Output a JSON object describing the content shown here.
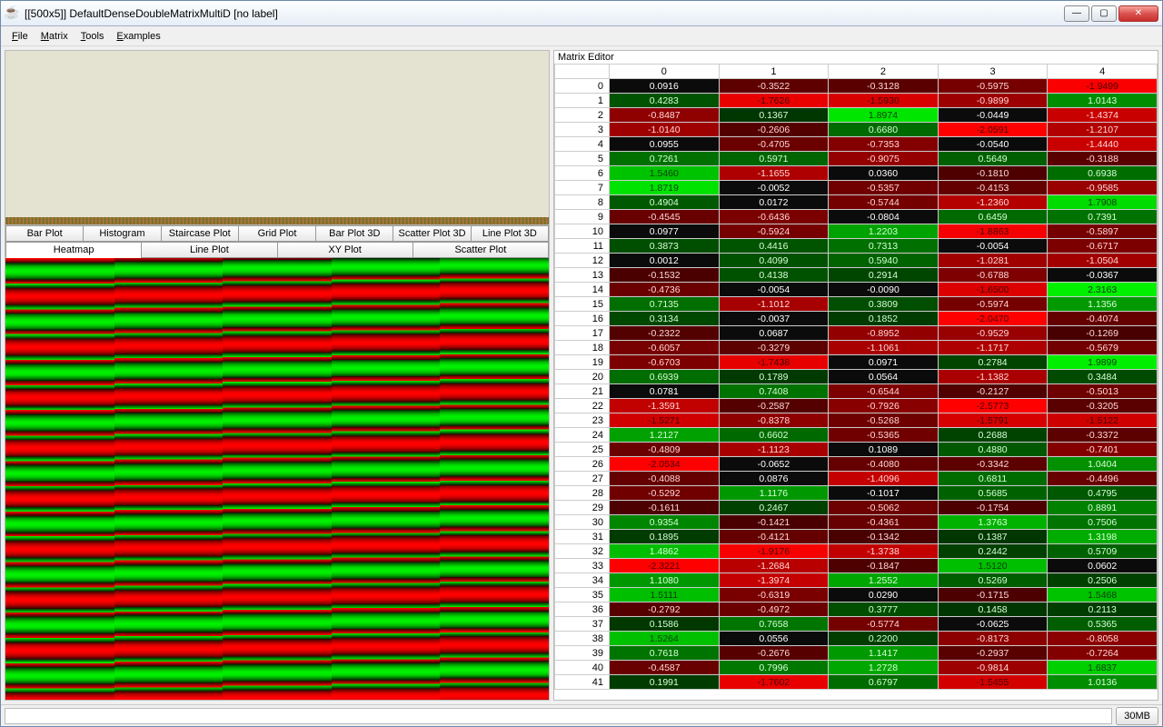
{
  "window": {
    "title": "[[500x5]] DefaultDenseDoubleMatrixMultiD [no label]"
  },
  "menubar": {
    "items": [
      "File",
      "Matrix",
      "Tools",
      "Examples"
    ]
  },
  "tabs_row1": [
    "Bar Plot",
    "Histogram",
    "Staircase Plot",
    "Grid Plot",
    "Bar Plot 3D",
    "Scatter Plot 3D",
    "Line Plot 3D"
  ],
  "tabs_row2": [
    "Heatmap",
    "Line Plot",
    "XY Plot",
    "Scatter Plot"
  ],
  "tabs_row2_active": "Heatmap",
  "editor_label": "Matrix Editor",
  "columns": [
    "0",
    "1",
    "2",
    "3",
    "4"
  ],
  "status": {
    "mem": "30MB"
  },
  "matrix": [
    [
      0.0916,
      -0.3522,
      -0.3128,
      -0.5975,
      -1.9499
    ],
    [
      0.4283,
      -1.7626,
      -1.593,
      -0.9899,
      1.0143
    ],
    [
      -0.8487,
      0.1367,
      1.8974,
      -0.0449,
      -1.4374
    ],
    [
      -1.014,
      -0.2606,
      0.668,
      -2.0591,
      -1.2107
    ],
    [
      0.0955,
      -0.4705,
      -0.7353,
      -0.054,
      -1.444
    ],
    [
      0.7261,
      0.5971,
      -0.9075,
      0.5649,
      -0.3188
    ],
    [
      1.546,
      -1.1655,
      0.036,
      -0.181,
      0.6938
    ],
    [
      1.8719,
      -0.0052,
      -0.5357,
      -0.4153,
      -0.9585
    ],
    [
      0.4904,
      0.0172,
      -0.5744,
      -1.236,
      1.7908
    ],
    [
      -0.4545,
      -0.6436,
      -0.0804,
      0.6459,
      0.7391
    ],
    [
      0.0977,
      -0.5924,
      1.2203,
      -1.8863,
      -0.5897
    ],
    [
      0.3873,
      0.4416,
      0.7313,
      -0.0054,
      -0.6717
    ],
    [
      0.0012,
      0.4099,
      0.594,
      -1.0281,
      -1.0504
    ],
    [
      -0.1532,
      0.4138,
      0.2914,
      -0.6788,
      -0.0367
    ],
    [
      -0.4736,
      -0.0054,
      -0.009,
      -1.65,
      2.3163
    ],
    [
      0.7135,
      -1.1012,
      0.3809,
      -0.5974,
      1.1356
    ],
    [
      0.3134,
      -0.0037,
      0.1852,
      -2.047,
      -0.4074
    ],
    [
      -0.2322,
      0.0687,
      -0.8952,
      -0.9529,
      -0.1269
    ],
    [
      -0.6057,
      -0.3279,
      -1.1061,
      -1.1717,
      -0.5679
    ],
    [
      -0.6703,
      -1.7438,
      0.0971,
      0.2784,
      1.9899
    ],
    [
      0.6939,
      0.1789,
      0.0564,
      -1.1382,
      0.3484
    ],
    [
      0.0781,
      0.7408,
      -0.6544,
      -0.2127,
      -0.5013
    ],
    [
      -1.3591,
      -0.2587,
      -0.7926,
      -2.5773,
      -0.3205
    ],
    [
      -1.5271,
      -0.8378,
      -0.5268,
      -1.5791,
      -1.5122
    ],
    [
      1.2127,
      0.6602,
      -0.5365,
      0.2688,
      -0.3372
    ],
    [
      -0.4809,
      -1.1123,
      0.1089,
      0.488,
      -0.7401
    ],
    [
      -2.0534,
      -0.0652,
      -0.408,
      -0.3342,
      1.0404
    ],
    [
      -0.4088,
      0.0876,
      -1.4096,
      0.6811,
      -0.4496
    ],
    [
      -0.5292,
      1.1176,
      -0.1017,
      0.5685,
      0.4795
    ],
    [
      -0.1611,
      0.2467,
      -0.5062,
      -0.1754,
      0.8891
    ],
    [
      0.9354,
      -0.1421,
      -0.4361,
      1.3763,
      0.7506
    ],
    [
      0.1895,
      -0.4121,
      -0.1342,
      0.1387,
      1.3198
    ],
    [
      1.4862,
      -1.9176,
      -1.3738,
      0.2442,
      0.5709
    ],
    [
      -2.3221,
      -1.2684,
      -0.1847,
      1.512,
      0.0602
    ],
    [
      1.108,
      -1.3974,
      1.2552,
      0.5269,
      0.2506
    ],
    [
      1.5111,
      -0.6319,
      0.029,
      -0.1715,
      1.5468
    ],
    [
      -0.2792,
      -0.4972,
      0.3777,
      0.1458,
      0.2113
    ],
    [
      0.1586,
      0.7658,
      -0.5774,
      -0.0625,
      0.5365
    ],
    [
      1.5264,
      0.0556,
      0.22,
      -0.8173,
      -0.8058
    ],
    [
      0.7618,
      -0.2676,
      1.1417,
      -0.2937,
      -0.7264
    ],
    [
      -0.4587,
      0.7996,
      1.2728,
      -0.9814,
      1.6837
    ],
    [
      0.1991,
      -1.7602,
      0.6797,
      -1.5455,
      1.0136
    ]
  ],
  "chart_data": {
    "type": "heatmap",
    "rows": 500,
    "cols": 5,
    "colormap": "red-black-green",
    "sample": "see matrix key for first 42 rows"
  }
}
